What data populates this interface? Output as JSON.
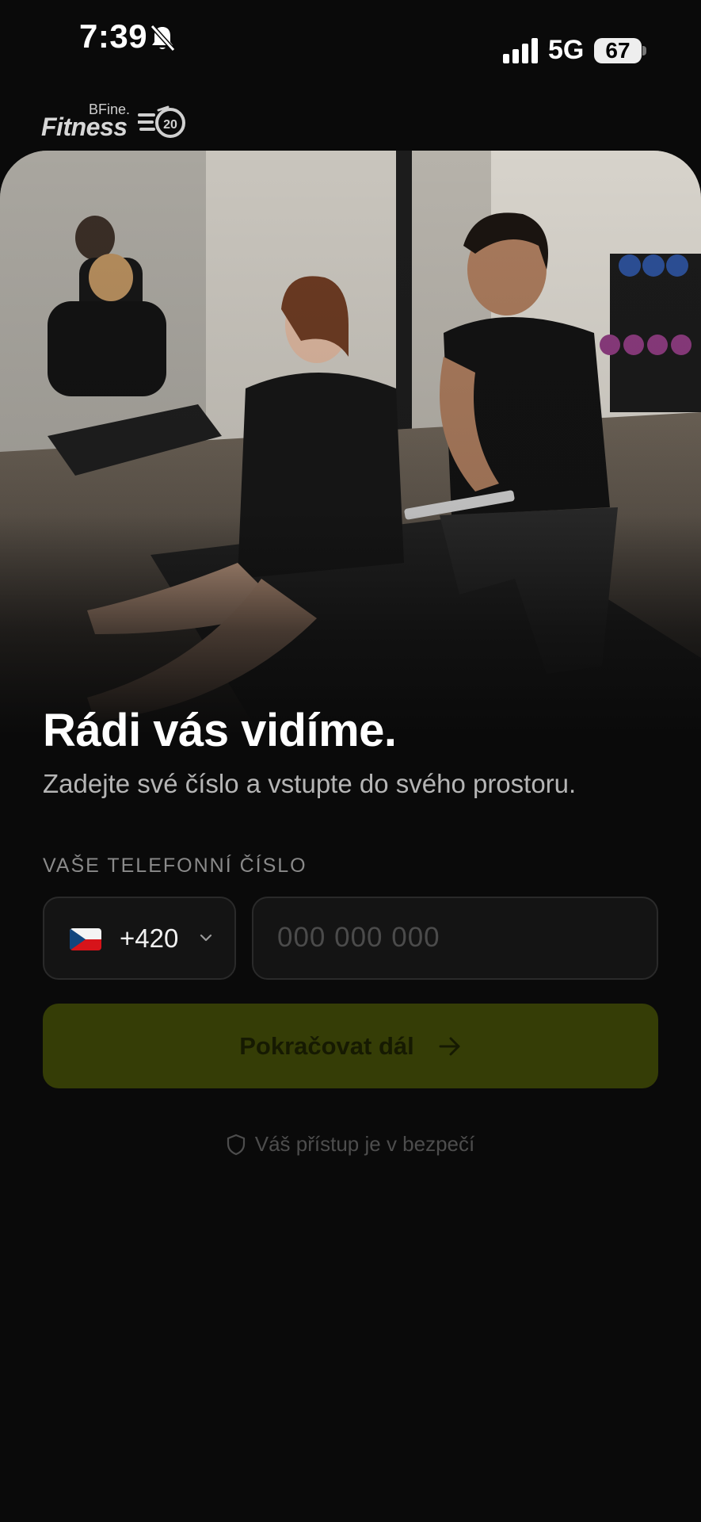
{
  "status_bar": {
    "time": "7:39",
    "network": "5G",
    "battery": "67"
  },
  "brand": {
    "tagline": "BFine.",
    "name": "Fitness",
    "badge_number": "20"
  },
  "hero": {
    "title": "Rádi vás vidíme.",
    "subtitle": "Zadejte své číslo a vstupte do svého prostoru."
  },
  "form": {
    "phone_label": "VAŠE TELEFONNÍ ČÍSLO",
    "country_code": "+420",
    "phone_placeholder": "000 000 000",
    "phone_value": "",
    "submit_label": "Pokračovat dál"
  },
  "footer": {
    "secure_text": "Váš přístup je v bezpečí"
  },
  "colors": {
    "background": "#0a0a0a",
    "button": "#353d06",
    "button_text": "#161a02",
    "input_bg": "#141414",
    "input_border": "#2a2a2a"
  },
  "icons": [
    "bell-off-icon",
    "signal-icon",
    "battery-icon",
    "czech-flag-icon",
    "chevron-down-icon",
    "arrow-right-icon",
    "shield-icon"
  ]
}
